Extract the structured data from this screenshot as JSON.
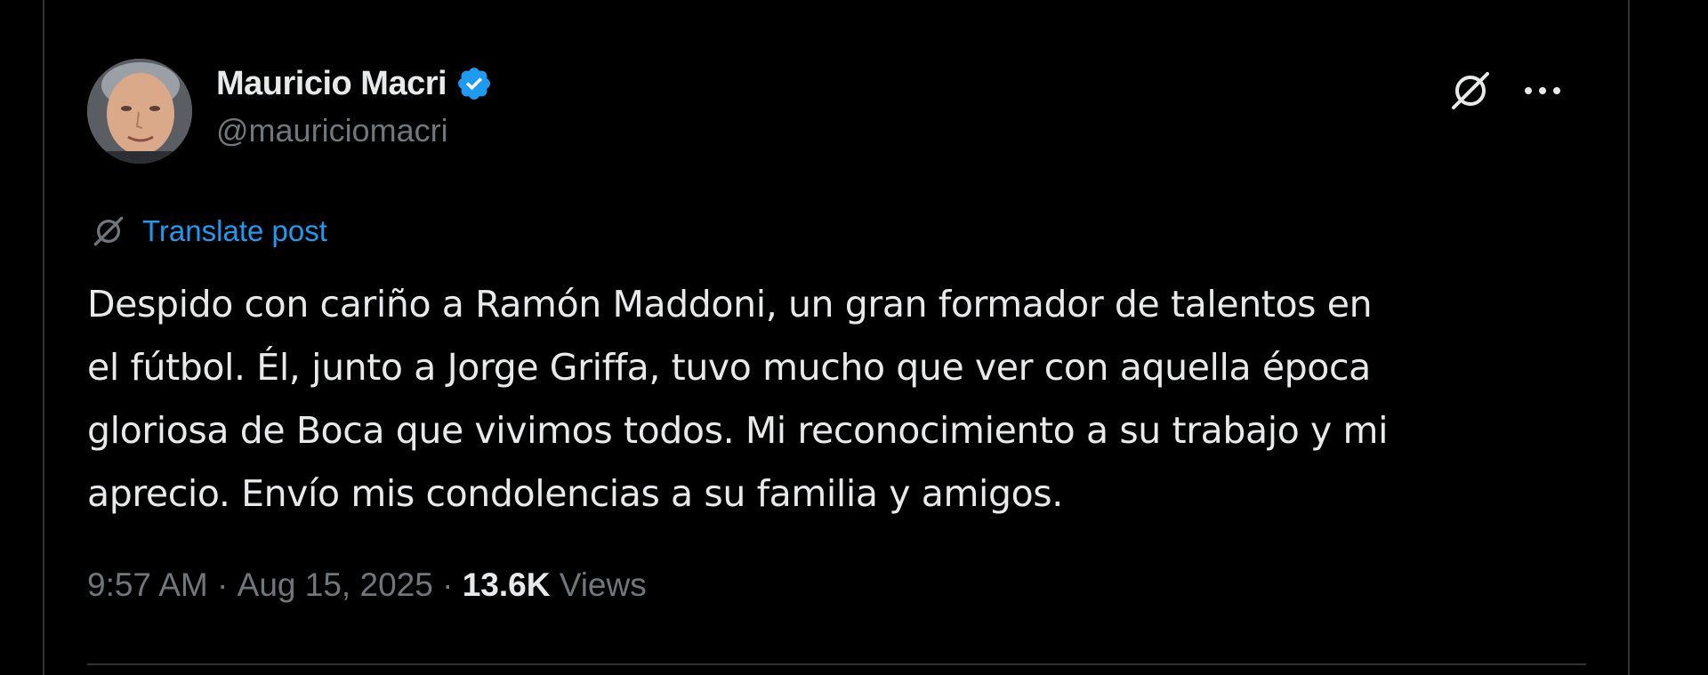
{
  "author": {
    "display_name": "Mauricio Macri",
    "handle": "@mauriciomacri",
    "verified_icon": "verified-badge-icon"
  },
  "actions": {
    "grok_icon": "grok-icon",
    "more_icon": "more-options-icon"
  },
  "translate": {
    "label": "Translate post"
  },
  "post": {
    "lines": [
      "Despido con cariño a Ramón Maddoni, un gran formador de talentos en",
      "el fútbol. Él, junto a Jorge Griffa, tuvo mucho que ver con aquella época",
      "gloriosa de Boca que vivimos todos. Mi reconocimiento a su trabajo y mi",
      "aprecio. Envío mis condolencias a su familia y amigos."
    ]
  },
  "meta": {
    "time": "9:57 AM",
    "separator": " · ",
    "date": "Aug 15, 2025",
    "separator2": " · ",
    "views_count": "13.6K",
    "views_label": " Views"
  },
  "colors": {
    "background": "#000000",
    "text": "#e7e9ea",
    "muted": "#71767b",
    "accent": "#1d9bf0"
  }
}
